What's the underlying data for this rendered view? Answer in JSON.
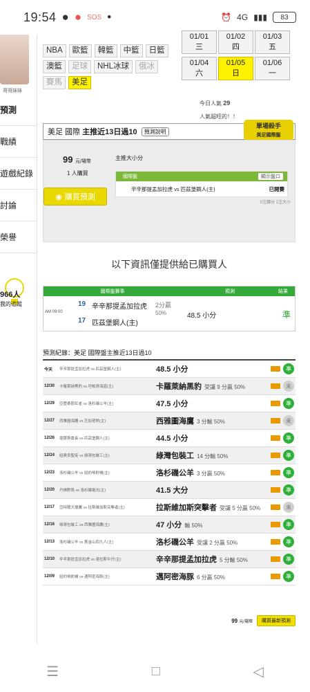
{
  "status": {
    "time": "19:54",
    "battery": "83",
    "signal": "4G"
  },
  "sidebar": {
    "avatar_name": "哥哥妹妹",
    "items": [
      "預測",
      "戰績",
      "遊戲紀錄",
      "討論",
      "榮譽"
    ],
    "count": "966人",
    "count_sub": "我的追蹤"
  },
  "leagues": [
    "NBA",
    "歐籃",
    "韓籃",
    "中籃",
    "日籃",
    "澳籃",
    "足球",
    "NHL冰球",
    "俄冰",
    "賽馬",
    "美足"
  ],
  "dates": [
    "01/01 三",
    "01/02 四",
    "01/03 五",
    "01/04 六",
    "01/05 日",
    "01/06 一"
  ],
  "hot": {
    "label": "今日人氣",
    "value": "29",
    "sub": "人氣超旺的！！"
  },
  "panel": {
    "title_prefix": "美足 國際",
    "title_main": "主推近13日過10",
    "tag": "預測說明",
    "kill": "單場殺手",
    "kill_sub": "美足國際盤",
    "price": "99",
    "price_unit": "元/場幣",
    "buyers": "1 人購買",
    "buy_label": "購買預測",
    "pick_label": "主推大小分",
    "game_head": "國際盤",
    "game_head_btn": "顯示盤口",
    "game_row": "辛辛那提孟加拉虎 vs 匹茲堡鋼人(主)",
    "game_status": "已開賽",
    "note": "0注讀分 1注大小"
  },
  "info_text": "以下資訊僅提供給已購買人",
  "paid": {
    "headers": [
      "國際盤賽事",
      "預測",
      "結果"
    ],
    "time": "AM 09:00",
    "away_num": "19",
    "away": "辛辛那提孟加拉虎",
    "home_num": "17",
    "home": "匹茲堡鋼人(主)",
    "spread": "2分贏",
    "pct": "50%",
    "pick": "48.5 小分",
    "result": "準"
  },
  "record_title": "預測紀錄：美足 國際盤主推近13日過10",
  "records": [
    {
      "date": "今天",
      "match": "辛辛那提孟加拉虎 vs 匹茲堡鋼人(主)",
      "pick": "48.5 小分",
      "note": "",
      "res": "準",
      "win": true
    },
    {
      "date": "12/30",
      "match": "卡羅萊納黑豹 vs 坦帕灣海盜(主)",
      "pick": "卡羅萊納黑豹",
      "note": "受讓 9 分贏 50%",
      "res": "未",
      "win": false
    },
    {
      "date": "12/29",
      "match": "亞歷桑那紅雀 vs 洛杉磯公羊(主)",
      "pick": "47.5 小分",
      "note": "",
      "res": "準",
      "win": true
    },
    {
      "date": "12/27",
      "match": "西雅圖海鷹 vs 芝加哥熊(主)",
      "pick": "西雅圖海鷹",
      "note": "3 分輸 50%",
      "res": "未",
      "win": false
    },
    {
      "date": "12/26",
      "match": "堪薩斯酋長 vs 匹茲堡鋼人(主)",
      "pick": "44.5 小分",
      "note": "",
      "res": "準",
      "win": true
    },
    {
      "date": "12/24",
      "match": "紐奧良聖徒 vs 綠灣包裝工(主)",
      "pick": "綠灣包裝工",
      "note": "14 分輸 50%",
      "res": "準",
      "win": true
    },
    {
      "date": "12/23",
      "match": "洛杉磯公羊 vs 紐約噴射機(主)",
      "pick": "洛杉磯公羊",
      "note": "3 分贏 50%",
      "res": "準",
      "win": true
    },
    {
      "date": "12/20",
      "match": "丹佛野馬 vs 洛杉磯電光(主)",
      "pick": "41.5 大分",
      "note": "",
      "res": "準",
      "win": true
    },
    {
      "date": "12/17",
      "match": "亞特蘭大獵鷹 vs 拉斯維加斯突擊者(主)",
      "pick": "拉斯維加斯突擊者",
      "note": "受讓 5 分贏 50%",
      "res": "未",
      "win": false
    },
    {
      "date": "12/16",
      "match": "綠灣包裝工 vs 西雅圖海鷹(主)",
      "pick": "47 小分",
      "note": "輸 50%",
      "res": "準",
      "win": true
    },
    {
      "date": "12/13",
      "match": "洛杉磯公羊 vs 舊金山四九人(主)",
      "pick": "洛杉磯公羊",
      "note": "受讓 2 分贏 50%",
      "res": "準",
      "win": true
    },
    {
      "date": "12/10",
      "match": "辛辛那提孟加拉虎 vs 達拉斯牛仔(主)",
      "pick": "辛辛那提孟加拉虎",
      "note": "5 分輸 50%",
      "res": "準",
      "win": true
    },
    {
      "date": "12/09",
      "match": "紐約噴射機 vs 邁阿密海豚(主)",
      "pick": "邁阿密海豚",
      "note": "6 分贏 50%",
      "res": "準",
      "win": true
    }
  ],
  "bottom": {
    "price": "99",
    "unit": "元/場幣",
    "btn": "購買最新預測"
  }
}
